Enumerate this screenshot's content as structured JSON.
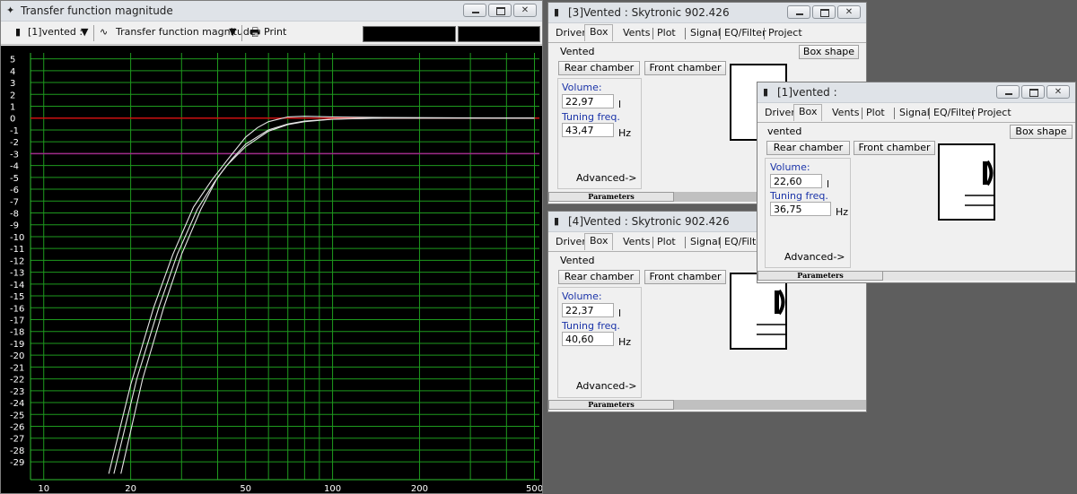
{
  "plot_window": {
    "title": "Transfer function magnitude",
    "toolbar": {
      "project_select": "[1]vented :",
      "view_select": "Transfer function magnitude",
      "print_label": "Print"
    }
  },
  "chart_data": {
    "type": "line",
    "title": "Transfer function magnitude",
    "x_scale": "log",
    "xlim": [
      9,
      520
    ],
    "ylim": [
      -30.5,
      5.5
    ],
    "x_tick_labels": [
      "10",
      "20",
      "50",
      "100",
      "200",
      "500"
    ],
    "x_ticks": [
      10,
      20,
      50,
      100,
      200,
      500
    ],
    "y_ticks": [
      5,
      4,
      3,
      2,
      1,
      0,
      -1,
      -2,
      -3,
      -4,
      -5,
      -6,
      -7,
      -8,
      -9,
      -10,
      -11,
      -12,
      -13,
      -14,
      -15,
      -16,
      -17,
      -18,
      -19,
      -20,
      -21,
      -22,
      -23,
      -24,
      -25,
      -26,
      -27,
      -28,
      -29
    ],
    "grid": true,
    "reference_lines": [
      {
        "y": 0,
        "color": "#cc1111"
      },
      {
        "y": -3,
        "color": "#a02a8a"
      }
    ],
    "series": [
      {
        "color": "#e6e6e6",
        "x": [
          18.5,
          22,
          26,
          30,
          35,
          40,
          45,
          50,
          60,
          70,
          80,
          100,
          150,
          250,
          500
        ],
        "y": [
          -30,
          -22,
          -16,
          -11.5,
          -7.7,
          -5.0,
          -3.4,
          -2.2,
          -1.0,
          -0.5,
          -0.25,
          -0.08,
          0,
          0,
          0
        ]
      },
      {
        "color": "#e6e6e6",
        "x": [
          17.5,
          21,
          25,
          29,
          34,
          39,
          43,
          50,
          60,
          70,
          80,
          100,
          150,
          250,
          500
        ],
        "y": [
          -30,
          -22,
          -16,
          -11.5,
          -7.7,
          -5.4,
          -4.0,
          -2.4,
          -1.1,
          -0.55,
          -0.3,
          -0.1,
          0,
          0,
          0
        ]
      },
      {
        "color": "#e6e6e6",
        "x": [
          16.8,
          20,
          24,
          28,
          33,
          38,
          43,
          50,
          55,
          60,
          70,
          80,
          100,
          150,
          500
        ],
        "y": [
          -30,
          -22.5,
          -16,
          -11.5,
          -7.5,
          -5.3,
          -3.6,
          -1.6,
          -0.8,
          -0.3,
          0.1,
          0.15,
          0.1,
          0.05,
          0
        ]
      }
    ]
  },
  "box_windows": [
    {
      "title": "[3]Vented : Skytronic 902.426",
      "tabs": [
        "Driver",
        "Box",
        "Vents",
        "Plot",
        "Signal",
        "EQ/Filter",
        "Project"
      ],
      "box_type": "Vented",
      "box_shape_label": "Box shape",
      "rear_chamber_label": "Rear chamber",
      "front_chamber_label": "Front chamber",
      "volume_label": "Volume:",
      "volume_value": "22,97",
      "volume_unit": "l",
      "tuning_label": "Tuning freq.",
      "tuning_value": "43,47",
      "tuning_unit": "Hz",
      "advanced_label": "Advanced->",
      "status_label": "Parameters"
    },
    {
      "title": "[4]Vented : Skytronic 902.426",
      "tabs": [
        "Driver",
        "Box",
        "Vents",
        "Plot",
        "Signal",
        "EQ/Filter"
      ],
      "box_type": "Vented",
      "rear_chamber_label": "Rear chamber",
      "front_chamber_label": "Front chamber",
      "volume_label": "Volume:",
      "volume_value": "22,37",
      "volume_unit": "l",
      "tuning_label": "Tuning freq.",
      "tuning_value": "40,60",
      "tuning_unit": "Hz",
      "advanced_label": "Advanced->",
      "status_label": "Parameters"
    },
    {
      "title": "[1]vented :",
      "tabs": [
        "Driver",
        "Box",
        "Vents",
        "Plot",
        "Signal",
        "EQ/Filter",
        "Project"
      ],
      "box_type": "vented",
      "box_shape_label": "Box shape",
      "rear_chamber_label": "Rear chamber",
      "front_chamber_label": "Front chamber",
      "volume_label": "Volume:",
      "volume_value": "22,60",
      "volume_unit": "l",
      "tuning_label": "Tuning freq.",
      "tuning_value": "36,75",
      "tuning_unit": "Hz",
      "advanced_label": "Advanced->",
      "status_label": "Parameters"
    }
  ]
}
